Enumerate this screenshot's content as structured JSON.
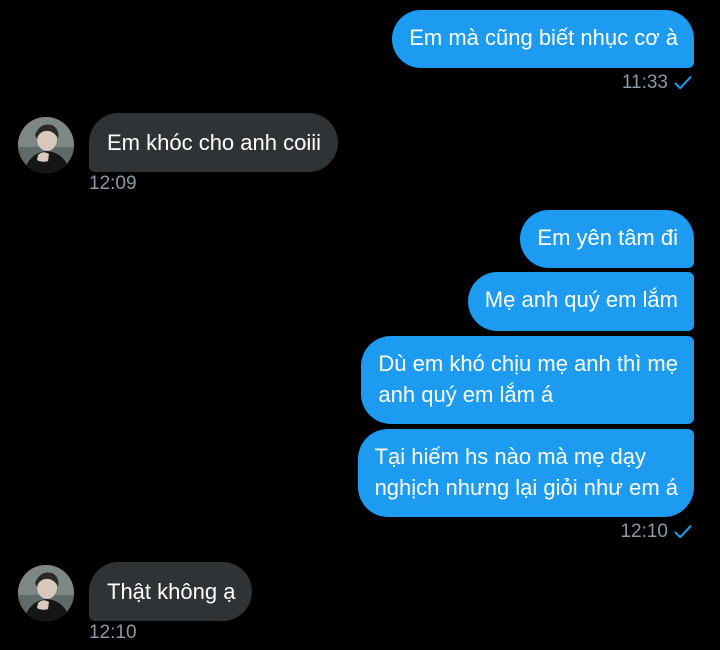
{
  "colors": {
    "background": "#000000",
    "outgoing_bubble": "#1d9bf0",
    "incoming_bubble": "#2f3336",
    "timestamp": "#8b98a5",
    "read_check": "#1d9bf0"
  },
  "messages": [
    {
      "direction": "outgoing",
      "text": "Em mà cũng biết nhục cơ à"
    },
    {
      "direction": "incoming",
      "text": "Em khóc cho anh coiii"
    },
    {
      "direction": "outgoing",
      "text": "Em yên tâm đi"
    },
    {
      "direction": "outgoing",
      "text": "Mẹ anh quý em lắm"
    },
    {
      "direction": "outgoing",
      "lines": [
        "Dù em khó chịu mẹ anh thì mẹ",
        "anh quý em lắm á"
      ]
    },
    {
      "direction": "outgoing",
      "lines": [
        "Tại hiếm hs nào mà mẹ dạy",
        "nghịch nhưng lại giỏi như em á"
      ]
    },
    {
      "direction": "incoming",
      "text": "Thật không ạ"
    }
  ],
  "timestamps": {
    "t1": "11:33",
    "t2": "12:09",
    "t3": "12:10",
    "t4": "12:10"
  },
  "icons": {
    "read_receipt": "check-icon",
    "avatar": "contact-avatar"
  }
}
